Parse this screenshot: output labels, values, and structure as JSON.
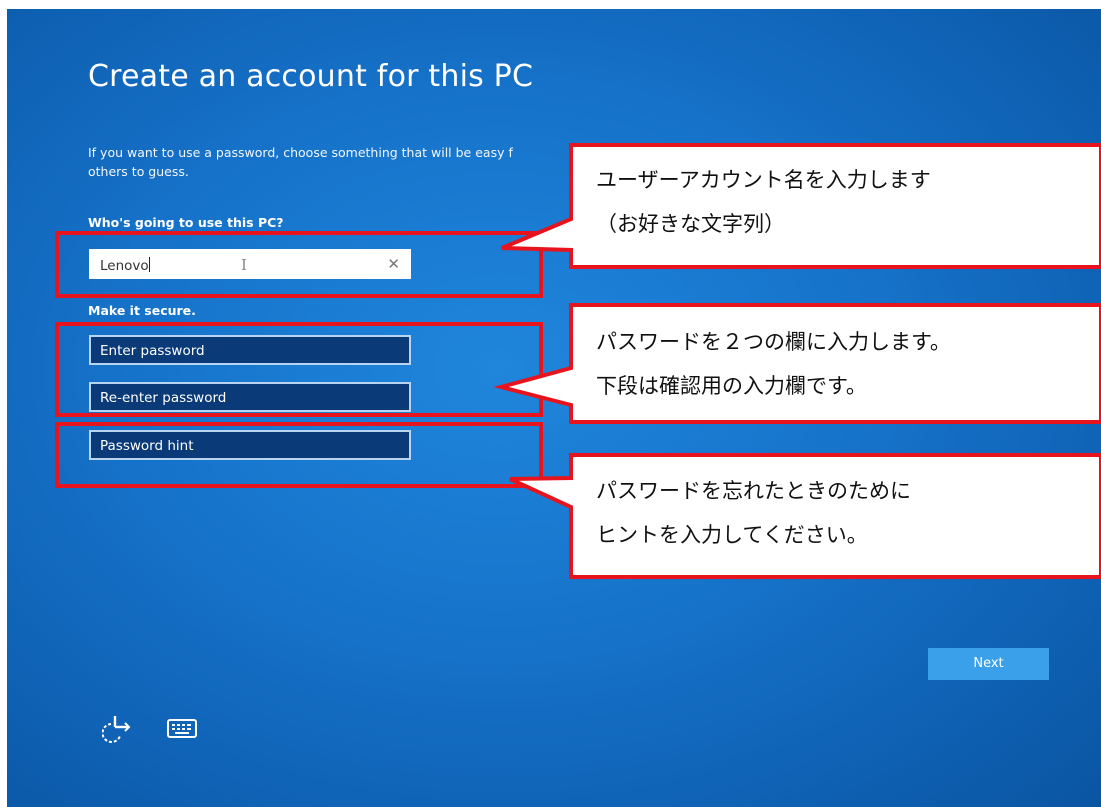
{
  "setup": {
    "title": "Create an account for this PC",
    "description_line1": "If you want to use a password, choose something that will be easy f",
    "description_line2": "others to guess.",
    "who_label": "Who's going to use this PC?",
    "username_value": "Lenovo",
    "secure_label": "Make it secure.",
    "password_placeholder": "Enter password",
    "reenter_placeholder": "Re-enter password",
    "hint_placeholder": "Password hint",
    "next_label": "Next",
    "clear_glyph": "✕",
    "ibeam_glyph": "I"
  },
  "footer": {
    "icons": [
      "accessibility-icon",
      "keyboard-icon"
    ]
  },
  "callouts": {
    "username": {
      "line1": "ユーザーアカウント名を入力します",
      "line2": "（お好きな文字列）"
    },
    "password": {
      "line1": "パスワードを２つの欄に入力します。",
      "line2": "下段は確認用の入力欄です。"
    },
    "hint": {
      "line1": "パスワードを忘れたときのために",
      "line2": "ヒントを入力してください。"
    }
  },
  "colors": {
    "annotation_red": "#e8141d",
    "screen_blue": "#1672c9",
    "next_button": "#3aa0e9"
  }
}
